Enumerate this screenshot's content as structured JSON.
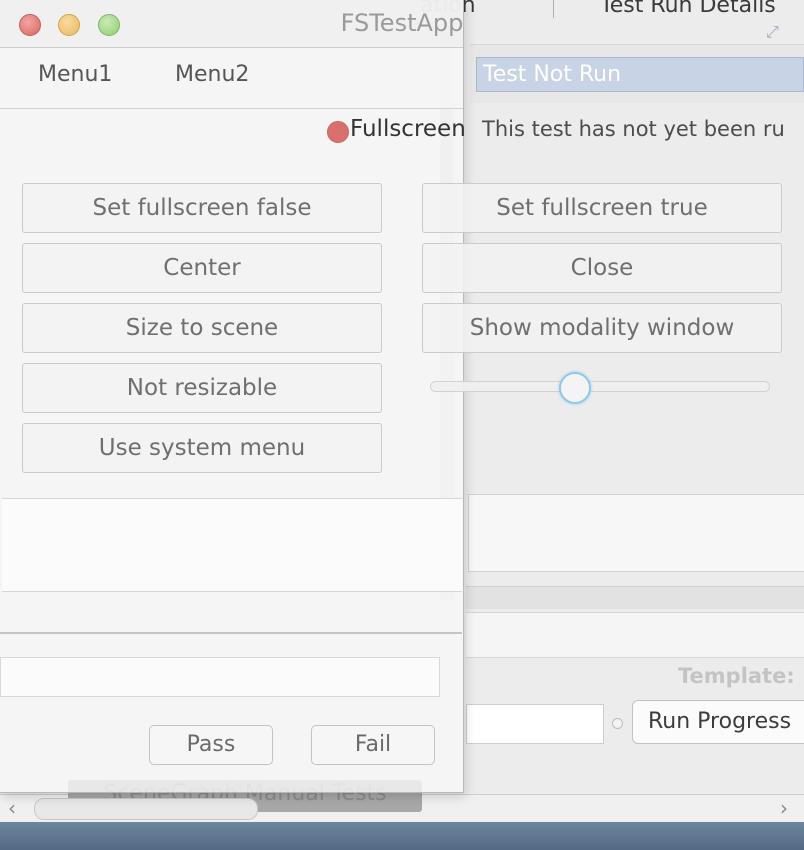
{
  "background_window": {
    "tabs": [
      "ation",
      "Test Run Details"
    ],
    "status_field": "Test Not Run",
    "description": "This test has not yet been ru",
    "template_label": "Template:",
    "run_progress_label": "Run Progress",
    "scenegraph_tab": "SceneGraph Manual Tests",
    "scroll_left": "‹",
    "scroll_right": "›"
  },
  "fs_window": {
    "title": "FSTestApp",
    "menus": [
      "Menu1",
      "Menu2"
    ],
    "status_title": "Fullscreen",
    "buttons_left": [
      "Set fullscreen false",
      "Center",
      "Size to scene",
      "Not resizable",
      "Use system menu"
    ],
    "buttons_right": [
      "Set fullscreen true",
      "Close",
      "Show modality window"
    ],
    "slider": {
      "value_fraction": 0.42
    },
    "pass_label": "Pass",
    "fail_label": "Fail"
  },
  "colors": {
    "status_dot": "#d9706e",
    "status_field_bg": "#c8d3e6",
    "slider_focus": "#8fc8e8"
  }
}
